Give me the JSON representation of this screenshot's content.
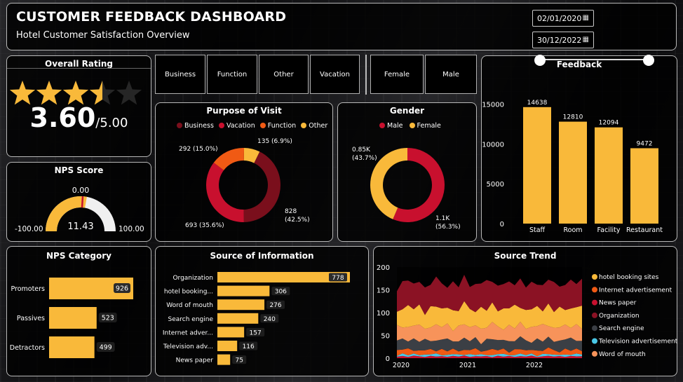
{
  "header": {
    "title": "CUSTOMER FEEDBACK DASHBOARD",
    "subtitle": "Hotel Customer Satisfaction Overview",
    "date_start": "02/01/2020",
    "date_end": "30/12/2022",
    "calendar_icon": "calendar-icon"
  },
  "slicers": {
    "purpose": [
      "Business",
      "Function",
      "Other",
      "Vacation"
    ],
    "gender": [
      "Female",
      "Male"
    ]
  },
  "overall_rating": {
    "title": "Overall Rating",
    "value": "3.60",
    "max": "/5.00",
    "stars": 3.6
  },
  "nps_score": {
    "title": "NPS Score",
    "value": "11.43",
    "min_label": "-100.00",
    "max_label": "100.00",
    "target_label": "0.00"
  },
  "colors": {
    "yellow": "#f9b93a",
    "red": "#c8102e",
    "darkred": "#7a0f1c",
    "orange": "#f05a14"
  },
  "chart_data": [
    {
      "type": "pie",
      "title": "Purpose of Visit",
      "legend": [
        "Business",
        "Vacation",
        "Function",
        "Other"
      ],
      "slices": [
        {
          "name": "Business",
          "value": 828,
          "label": "828 (42.5%)",
          "color": "#7a0f1c"
        },
        {
          "name": "Vacation",
          "value": 693,
          "label": "693 (35.6%)",
          "color": "#c8102e"
        },
        {
          "name": "Function",
          "value": 292,
          "label": "292 (15.0%)",
          "color": "#f05a14"
        },
        {
          "name": "Other",
          "value": 135,
          "label": "135 (6.9%)",
          "color": "#f9b93a"
        }
      ]
    },
    {
      "type": "pie",
      "title": "Gender",
      "legend": [
        "Male",
        "Female"
      ],
      "slices": [
        {
          "name": "Male",
          "value": 1100,
          "label": "1.1K (56.3%)",
          "color": "#c8102e"
        },
        {
          "name": "Female",
          "value": 850,
          "label": "0.85K (43.7%)",
          "color": "#f9b93a"
        }
      ]
    },
    {
      "type": "bar",
      "title": "Feedback",
      "categories": [
        "Staff",
        "Room",
        "Facility",
        "Restaurant"
      ],
      "values": [
        14638,
        12810,
        12094,
        9472
      ],
      "ylim": [
        0,
        17000
      ],
      "yticks": [
        "0",
        "5000",
        "10000",
        "15000"
      ],
      "ytick_values": [
        0,
        5000,
        10000,
        15000
      ]
    },
    {
      "type": "bar",
      "orientation": "horizontal",
      "title": "NPS Category",
      "categories": [
        "Promoters",
        "Passives",
        "Detractors"
      ],
      "values": [
        926,
        523,
        499
      ]
    },
    {
      "type": "bar",
      "orientation": "horizontal",
      "title": "Source of Information",
      "categories": [
        "Organization",
        "hotel booking...",
        "Word of mouth",
        "Search engine",
        "Internet adver...",
        "Television adv...",
        "News paper"
      ],
      "values": [
        778,
        306,
        276,
        240,
        157,
        116,
        75
      ]
    },
    {
      "type": "area",
      "title": "Source Trend",
      "yticks": [
        "0",
        "50",
        "100",
        "150",
        "200"
      ],
      "ytick_values": [
        0,
        50,
        100,
        150,
        200
      ],
      "xticks": [
        "2020",
        "2021",
        "2022"
      ],
      "legend": [
        "hotel booking sites",
        "Internet advertisement",
        "News paper",
        "Organization",
        "Search engine",
        "Television advertisement",
        "Word of mouth"
      ],
      "series": [
        {
          "name": "News paper",
          "color": "#c8102e"
        },
        {
          "name": "Television advertisement",
          "color": "#49c7e6"
        },
        {
          "name": "Internet advertisement",
          "color": "#f05a14"
        },
        {
          "name": "Search engine",
          "color": "#3b3f45"
        },
        {
          "name": "Word of mouth",
          "color": "#f7935a"
        },
        {
          "name": "hotel booking sites",
          "color": "#f9b93a"
        },
        {
          "name": "Organization",
          "color": "#8b1224"
        }
      ]
    }
  ]
}
